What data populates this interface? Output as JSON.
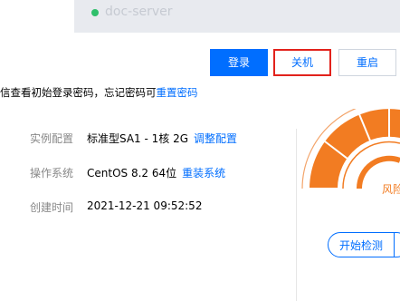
{
  "tab": {
    "server_name": "doc-server"
  },
  "actions": {
    "login_label": "登录",
    "shutdown_label": "关机",
    "restart_label": "重启"
  },
  "hint": {
    "prefix": "信查看初始登录密码，忘记密码可",
    "link": "重置密码"
  },
  "info": {
    "spec": {
      "label": "实例配置",
      "value": "标准型SA1 - 1核 2G",
      "link": "调整配置"
    },
    "os": {
      "label": "操作系统",
      "value": "CentOS 8.2 64位",
      "link": "重装系统"
    },
    "created": {
      "label": "创建时间",
      "value": "2021-12-21 09:52:52"
    }
  },
  "security": {
    "gauge_text": "风险",
    "check_label": "开始检测"
  },
  "colors": {
    "accent": "#006eff",
    "highlight_border": "#e2221c",
    "gauge_orange": "#f27c22",
    "status_green": "#2fbf6b"
  }
}
